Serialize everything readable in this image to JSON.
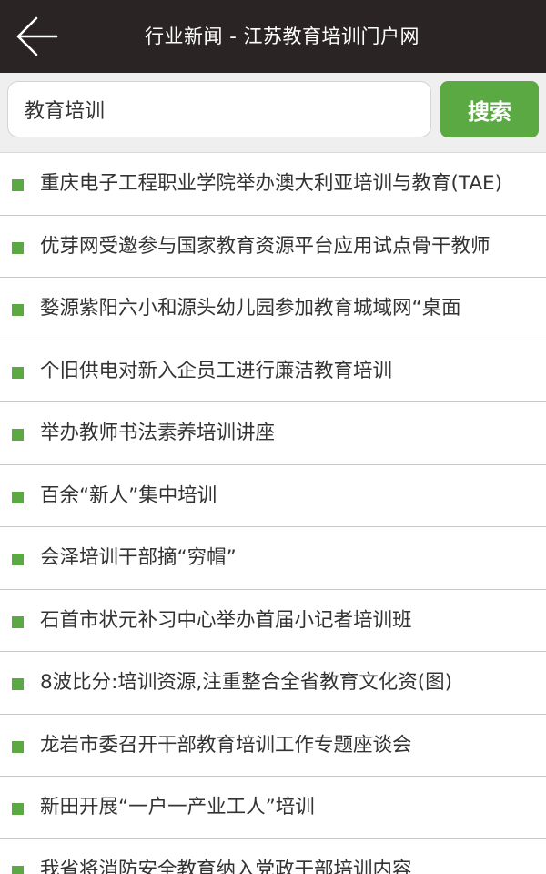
{
  "header": {
    "title": "行业新闻 - 江苏教育培训门户网",
    "back_icon": "arrow-left-icon"
  },
  "search": {
    "value": "教育培训",
    "button_label": "搜索"
  },
  "colors": {
    "header_bg": "#2b2424",
    "accent": "#5aa942",
    "list_text": "#333333"
  },
  "news": [
    {
      "title": "重庆电子工程职业学院举办澳大利亚培训与教育(TAE)"
    },
    {
      "title": "优芽网受邀参与国家教育资源平台应用试点骨干教师"
    },
    {
      "title": "婺源紫阳六小和源头幼儿园参加教育城域网“桌面"
    },
    {
      "title": "个旧供电对新入企员工进行廉洁教育培训"
    },
    {
      "title": "举办教师书法素养培训讲座"
    },
    {
      "title": "百余“新人”集中培训"
    },
    {
      "title": "会泽培训干部摘“穷帽”"
    },
    {
      "title": "石首市状元补习中心举办首届小记者培训班"
    },
    {
      "title": "8波比分:培训资源,注重整合全省教育文化资(图)"
    },
    {
      "title": "龙岩市委召开干部教育培训工作专题座谈会"
    },
    {
      "title": "新田开展“一户一产业工人”培训"
    },
    {
      "title": "我省将消防安全教育纳入党政干部培训内容"
    }
  ]
}
